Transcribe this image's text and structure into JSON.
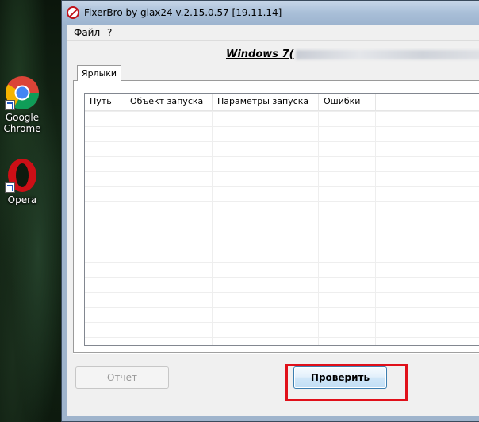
{
  "desktop": {
    "icons": [
      {
        "label": "Google\nChrome",
        "icon": "chrome-icon"
      },
      {
        "label": "Opera",
        "icon": "opera-icon"
      }
    ]
  },
  "window": {
    "title": "FixerBro by glax24 v.2.15.0.57 [19.11.14]",
    "menu": [
      "Файл",
      "?"
    ],
    "os_label": "Windows 7(",
    "tab": "Ярлыки",
    "columns": [
      "Путь",
      "Объект запуска",
      "Параметры запуска",
      "Ошибки"
    ],
    "buttons": {
      "report": "Отчет",
      "check": "Проверить"
    }
  },
  "colors": {
    "highlight": "#e0101a",
    "titlebar": "#a9bfd8"
  }
}
